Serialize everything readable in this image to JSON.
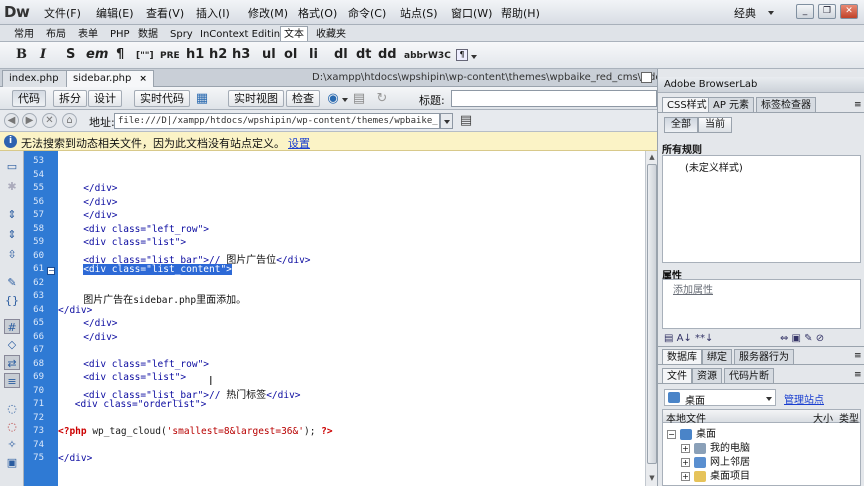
{
  "app": {
    "logo": "Dw",
    "layout": "经典"
  },
  "menu": [
    "文件(F)",
    "编辑(E)",
    "查看(V)",
    "插入(I)",
    "修改(M)",
    "格式(O)",
    "命令(C)",
    "站点(S)",
    "窗口(W)",
    "帮助(H)"
  ],
  "insert_tabs": [
    "常用",
    "布局",
    "表单",
    "PHP",
    "数据",
    "Spry",
    "InContext Editing",
    "文本",
    "收藏夹"
  ],
  "insert_tabs_active": "文本",
  "format_buttons": [
    "B",
    "I",
    "S",
    "em",
    "¶",
    "[\"\"]",
    "PRE",
    "h1",
    "h2",
    "h3",
    "ul",
    "ol",
    "li",
    "dl",
    "dt",
    "dd",
    "abbr",
    "W3C"
  ],
  "file_tabs": [
    {
      "label": "index.php",
      "close": "×",
      "active": false
    },
    {
      "label": "sidebar.php",
      "close": "×",
      "active": true
    }
  ],
  "file_path": "D:\\xampp\\htdocs\\wpshipin\\wp-content\\themes\\wpbaike_red_cms\\sidebar.php",
  "doc_toolbar": {
    "code": "代码",
    "split": "拆分",
    "design": "设计",
    "live_code": "实时代码",
    "live_view": "实时视图",
    "inspect": "检查",
    "title_label": "标题:"
  },
  "address": {
    "label": "地址:",
    "value": "file:///D|/xampp/htdocs/wpshipin/wp-content/themes/wpbaike_red_"
  },
  "info_bar": {
    "text": "无法搜索到动态相关文件，因为此文档没有站点定义。",
    "link": "设置"
  },
  "code": {
    "line_numbers": [
      "53",
      "54",
      "55",
      "56",
      "57",
      "58",
      "59",
      "60",
      "61",
      "62",
      "63",
      "64",
      "65",
      "66",
      "67",
      "68",
      "69",
      "70",
      "71",
      "72",
      "73",
      "74",
      "75"
    ],
    "lines": [
      {
        "text": "",
        "indent": 0
      },
      {
        "text": "",
        "indent": 0
      },
      {
        "text": "</div>",
        "indent": 3
      },
      {
        "text": "</div>",
        "indent": 3
      },
      {
        "text": "</div>",
        "indent": 3
      },
      {
        "text": "<div class=\"left_row\">",
        "indent": 3
      },
      {
        "text": "<div class=\"list\">",
        "indent": 3
      },
      {
        "text": "<div class=\"list_bar\">// ",
        "indent": 3,
        "comment": "图片广告位",
        "tail": "</div>"
      },
      {
        "text": "<div class=\"list_content\">",
        "indent": 3,
        "selected": true
      },
      {
        "text": "",
        "indent": 0
      },
      {
        "text": "图片广告在",
        "indent": 3,
        "plain": true,
        "mono": "sidebar.php",
        "tail": "里面添加。"
      },
      {
        "text": "</div>",
        "indent": 0
      },
      {
        "text": "</div>",
        "indent": 3
      },
      {
        "text": "</div>",
        "indent": 3
      },
      {
        "text": "",
        "indent": 0
      },
      {
        "text": "<div class=\"left_row\">",
        "indent": 3
      },
      {
        "text": "<div class=\"list\">",
        "indent": 3
      },
      {
        "text": "<div class=\"list_bar\">// ",
        "indent": 3,
        "comment": "热门标签",
        "tail": "</div>"
      },
      {
        "text": "<div class=\"orderlist\">",
        "indent": 2
      },
      {
        "text": "",
        "indent": 0
      },
      {
        "php": true,
        "open": "<?php",
        "fn": " wp_tag_cloud(",
        "arg": "'smallest=8&largest=36&'",
        "close_paren": "); ",
        "end": "?>"
      },
      {
        "text": "",
        "indent": 0
      },
      {
        "text": "</div>",
        "indent": 0
      }
    ]
  },
  "right_panel": {
    "browserlab": "Adobe BrowserLab",
    "css_tabs": [
      "CSS样式",
      "AP 元素",
      "标签检查器"
    ],
    "css_active": "CSS样式",
    "css_buttons": [
      "全部",
      "当前"
    ],
    "all_rules": "所有规则",
    "undefined_style": "(未定义样式)",
    "properties": "属性",
    "add_property": "添加属性",
    "db_tabs": [
      "数据库",
      "绑定",
      "服务器行为"
    ],
    "file_tabs": [
      "文件",
      "资源",
      "代码片断"
    ],
    "site_select": "桌面",
    "manage_site": "管理站点",
    "columns": [
      "本地文件",
      "大小",
      "类型"
    ],
    "tree": [
      {
        "label": "桌面",
        "level": 0,
        "expander": "−"
      },
      {
        "label": "我的电脑",
        "level": 1,
        "expander": "+"
      },
      {
        "label": "网上邻居",
        "level": 1,
        "expander": "+"
      },
      {
        "label": "桌面项目",
        "level": 1,
        "expander": "+"
      }
    ]
  },
  "colors": {
    "gutter": "#2f7ad4",
    "selection": "#2d69d6",
    "code_tag": "#0b0ba0",
    "php_tag": "#cc0000",
    "info_bar_bg": "#fbf3c6",
    "link": "#1a3fd0"
  }
}
